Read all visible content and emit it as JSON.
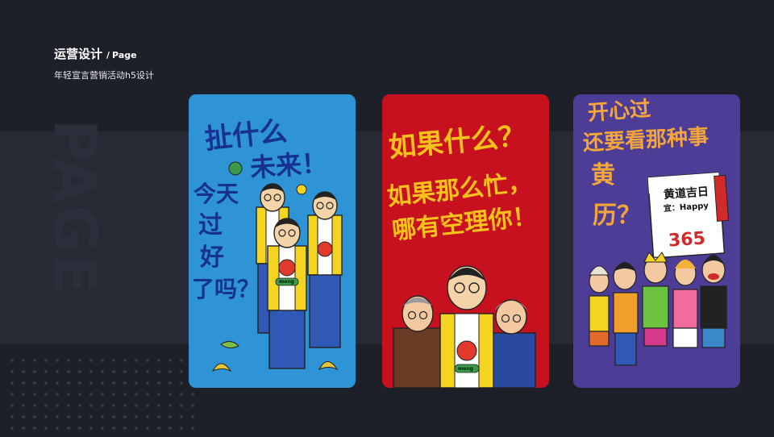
{
  "header": {
    "title": "运营设计",
    "separator": "/",
    "page_label": "Page",
    "subtitle": "年轻宣言营销活动h5设计"
  },
  "watermark": "PAGE",
  "cards": [
    {
      "background": "#2f94d6",
      "lines": [
        "扯什么",
        "未来！",
        "今天",
        "过",
        "好",
        "了吗？"
      ],
      "badge": "meng"
    },
    {
      "background": "#c8111f",
      "lines": [
        "如果什么？",
        "如果那么忙，",
        "哪有空理你！"
      ],
      "badge": "meng"
    },
    {
      "background": "#4e3d96",
      "lines": [
        "开心过",
        "还要看那种事",
        "黄",
        "历？"
      ],
      "calendar_title": "黄道吉日",
      "calendar_line": "宜：Happy",
      "calendar_number": "365"
    }
  ]
}
